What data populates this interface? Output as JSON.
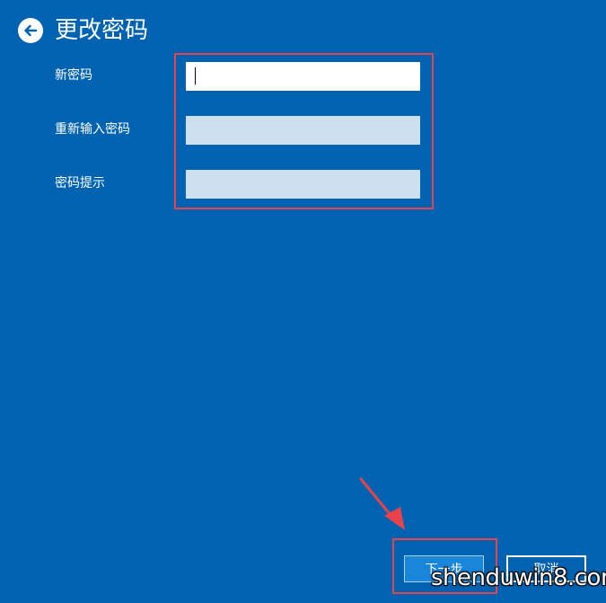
{
  "header": {
    "title": "更改密码",
    "back_icon": "arrow-left-icon"
  },
  "form": {
    "new_password_label": "新密码",
    "new_password_value": "",
    "confirm_password_label": "重新输入密码",
    "confirm_password_value": "",
    "password_hint_label": "密码提示",
    "password_hint_value": ""
  },
  "buttons": {
    "next_label": "下一步",
    "cancel_label": "取消"
  },
  "watermark": "shenduwin8.com",
  "colors": {
    "background": "#0063b1",
    "highlight": "#e8424a",
    "field_inactive": "#cce0ef",
    "next_button": "#1a86d9"
  }
}
